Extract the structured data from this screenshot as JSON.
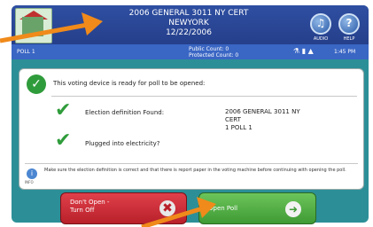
{
  "header": {
    "line1": "2006 GENERAL 3011 NY CERT",
    "line2": "NEWYORK",
    "line3": "12/22/2006",
    "btn1_label": "AUDIO",
    "btn2_label": "HELP",
    "btn1_icon": "audio-icon",
    "btn2_icon": "help-icon"
  },
  "status": {
    "poll": "POLL 1",
    "counts_line1": "Public Count: 0",
    "counts_line2": "Protected Count: 0",
    "time": "1:45 PM",
    "icons": [
      "network-icon",
      "battery-icon",
      "signal-icon"
    ]
  },
  "panel": {
    "ready_text": "This voting device is ready for poll to be opened:",
    "item1": "Election definition Found:",
    "item2": "Plugged into electricity?",
    "election_line1": "2006 GENERAL 3011 NY",
    "election_line2": "CERT",
    "election_line3": "1 POLL 1",
    "note": "Make sure the election definition is correct and that there is report paper in the voting machine before continuing with opening the poll.",
    "info_label": "INFO"
  },
  "buttons": {
    "cancel_line1": "Don't Open -",
    "cancel_line2": "Turn Off",
    "open_label": "Open Poll"
  },
  "colors": {
    "frame": "#2c8f97",
    "header": "#2f4fa2",
    "status": "#3a66c4",
    "red_button": "#c8303a",
    "green_button": "#4fae3f",
    "arrow": "#f08a1a"
  }
}
